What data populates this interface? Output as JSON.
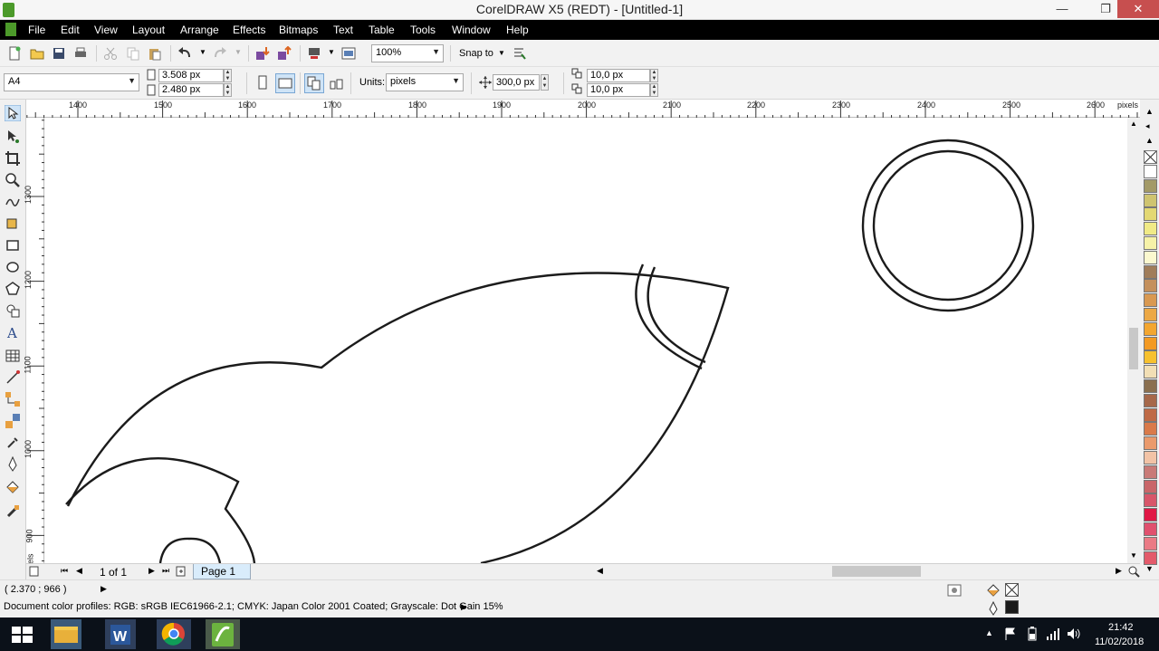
{
  "window": {
    "title": "CorelDRAW X5 (REDT) - [Untitled-1]",
    "controls": {
      "minimize": "—",
      "maximize": "❐",
      "close": "✕"
    }
  },
  "menu": {
    "items": [
      "File",
      "Edit",
      "View",
      "Layout",
      "Arrange",
      "Effects",
      "Bitmaps",
      "Text",
      "Table",
      "Tools",
      "Window",
      "Help"
    ]
  },
  "toolbar": {
    "zoom_value": "100%",
    "snap_to_label": "Snap to"
  },
  "property_bar": {
    "page_size": "A4",
    "width": "3.508 px",
    "height": "2.480 px",
    "units_label": "Units:",
    "units_value": "pixels",
    "nudge": "300,0 px",
    "dup_x": "10,0 px",
    "dup_y": "10,0 px"
  },
  "rulers": {
    "horizontal_labels": [
      "1400",
      "1500",
      "1600",
      "1700",
      "1800",
      "1900",
      "2000",
      "2100",
      "2200",
      "2300",
      "2400",
      "2500",
      "2600"
    ],
    "horizontal_unit": "pixels",
    "vertical_labels": [
      "1300",
      "1200",
      "1100",
      "1000",
      "900"
    ],
    "vertical_unit": "pixels"
  },
  "page_nav": {
    "counter": "1 of 1",
    "tab": "Page 1"
  },
  "status": {
    "coordinates": "( 2.370 ; 966 )",
    "color_profiles": "Document color profiles: RGB: sRGB IEC61966-2.1; CMYK: Japan Color 2001 Coated; Grayscale: Dot Gain 15%"
  },
  "palette": {
    "colors": [
      "#ffffff",
      "#a39a67",
      "#cfc470",
      "#e3d873",
      "#f0ea86",
      "#f6f2a8",
      "#fbf8cf",
      "#a07d5a",
      "#c4905c",
      "#d99951",
      "#eca845",
      "#f3a630",
      "#f39a23",
      "#f7c12e",
      "#f2dfb5",
      "#8a6f4f",
      "#a6684a",
      "#bf6a46",
      "#d97a4a",
      "#ea9a6c",
      "#f2c3a6",
      "#c97a77",
      "#c96669",
      "#d8566a",
      "#e01745",
      "#e0506e",
      "#ea7a85",
      "#e35a6a"
    ]
  },
  "taskbar": {
    "time": "21:42",
    "date": "11/02/2018"
  }
}
